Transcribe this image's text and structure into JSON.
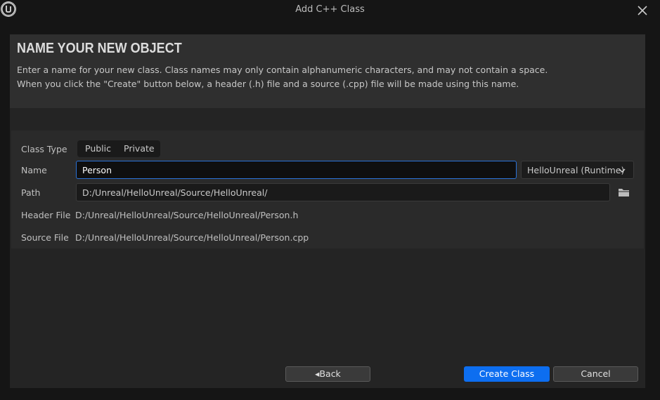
{
  "window": {
    "title": "Add C++ Class",
    "logo_icon": "unreal-engine-logo"
  },
  "header": {
    "title": "NAME YOUR NEW OBJECT",
    "line1": "Enter a name for your new class. Class names may only contain alphanumeric characters, and may not contain a space.",
    "line2": "When you click the \"Create\" button below, a header (.h) file and a source (.cpp) file will be made using this name."
  },
  "form": {
    "class_type_label": "Class Type",
    "class_type_options": [
      "Public",
      "Private"
    ],
    "name_label": "Name",
    "name_value": "Person",
    "module": "HelloUnreal (Runtime)",
    "path_label": "Path",
    "path_value": "D:/Unreal/HelloUnreal/Source/HelloUnreal/",
    "header_file_label": "Header File",
    "header_file_value": "D:/Unreal/HelloUnreal/Source/HelloUnreal/Person.h",
    "source_file_label": "Source File",
    "source_file_value": "D:/Unreal/HelloUnreal/Source/HelloUnreal/Person.cpp"
  },
  "footer": {
    "back_label": "Back",
    "create_label": "Create Class",
    "cancel_label": "Cancel"
  },
  "colors": {
    "accent": "#0d6ef0",
    "focus_border": "#2a72d8",
    "panel_bg": "#242424"
  }
}
